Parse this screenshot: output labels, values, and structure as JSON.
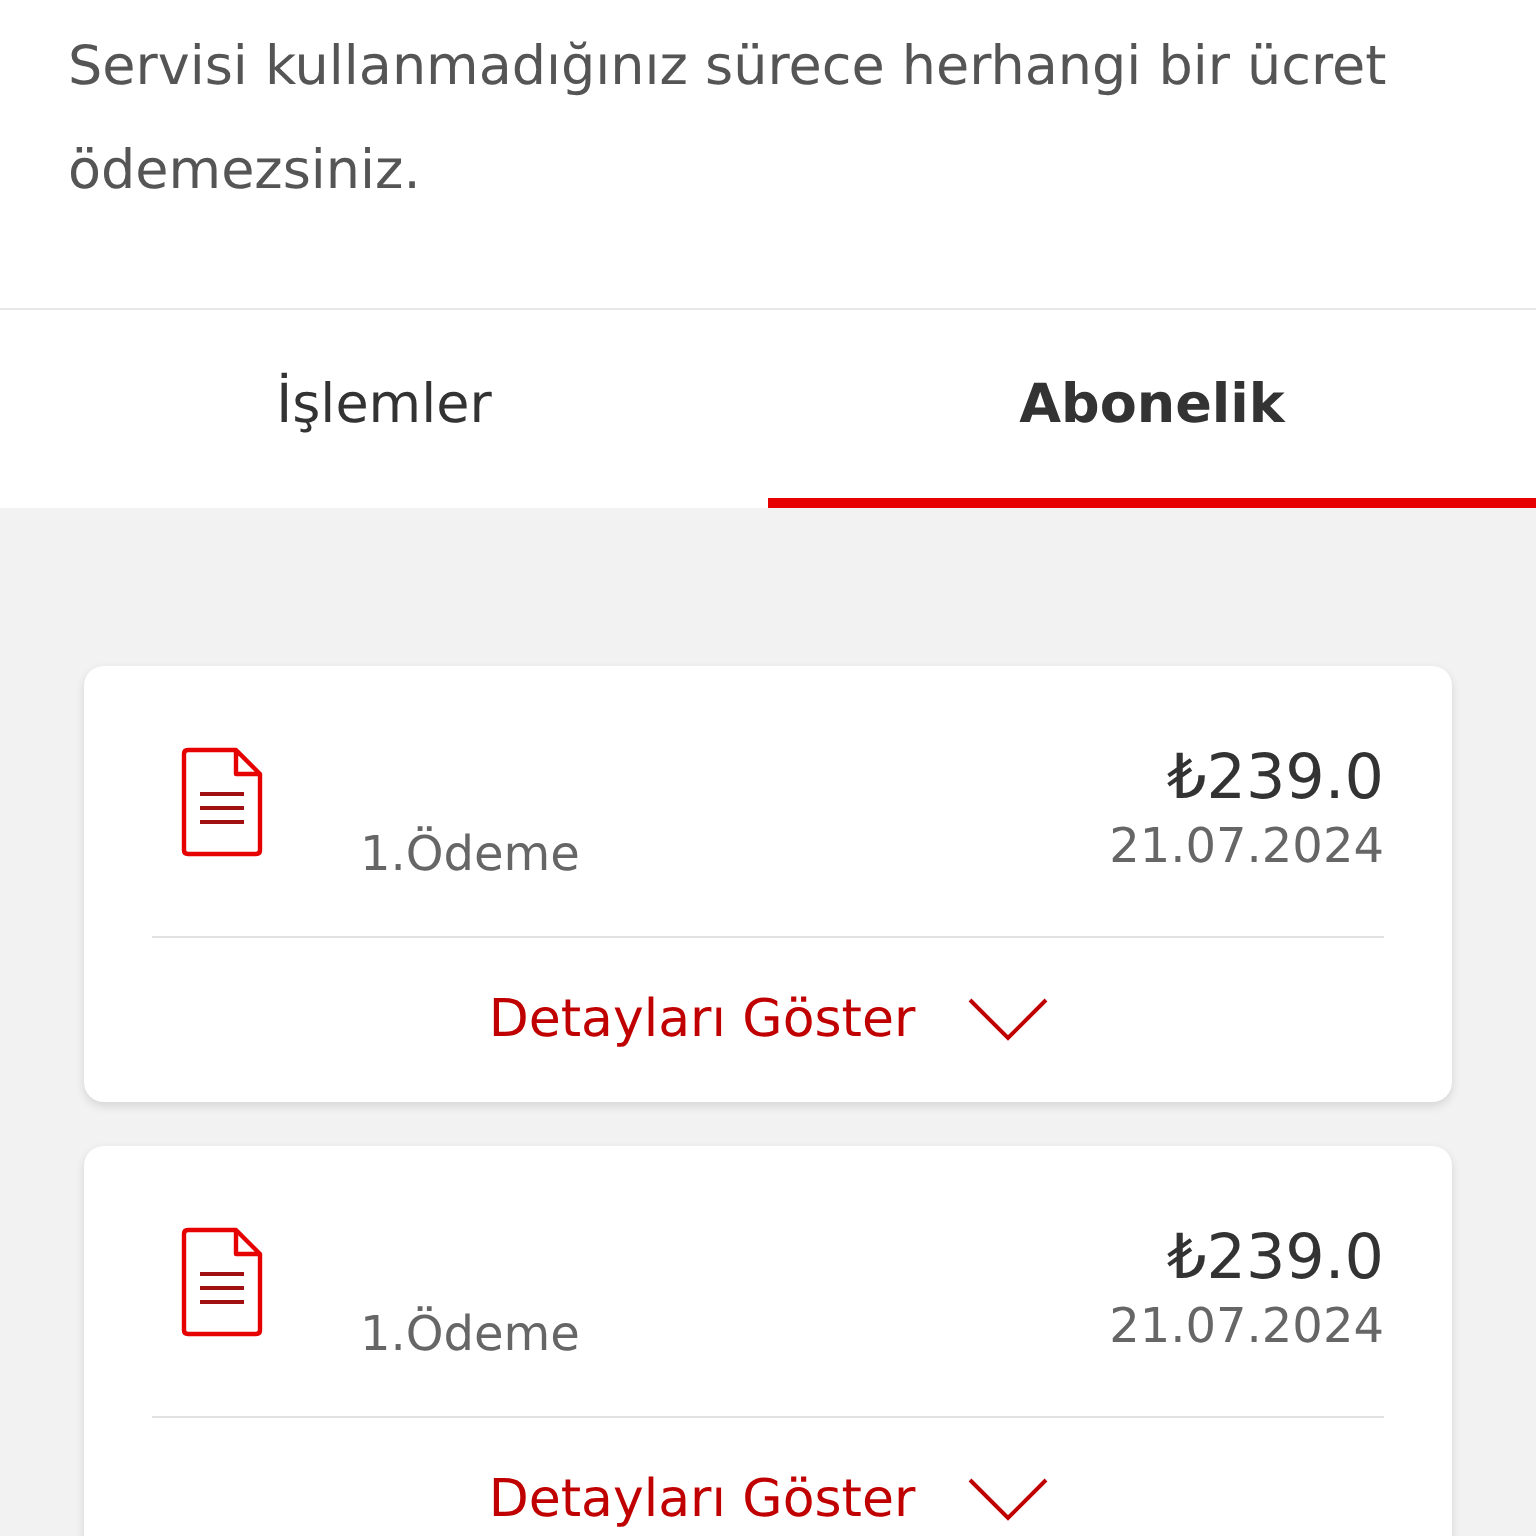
{
  "intro": "Servisi kullanmadığınız sürece herhangi bir ücret ödemezsiniz.",
  "tabs": [
    {
      "label": "İşlemler",
      "selected": false
    },
    {
      "label": "Abonelik",
      "selected": true
    }
  ],
  "payments": [
    {
      "label": "1.Ödeme",
      "amount": "₺239.0",
      "date": "21.07.2024",
      "toggle": "Detayları Göster",
      "expanded": false
    },
    {
      "label": "1.Ödeme",
      "amount": "₺239.0",
      "date": "21.07.2024",
      "toggle": "Detayları Göster",
      "expanded": false
    }
  ]
}
